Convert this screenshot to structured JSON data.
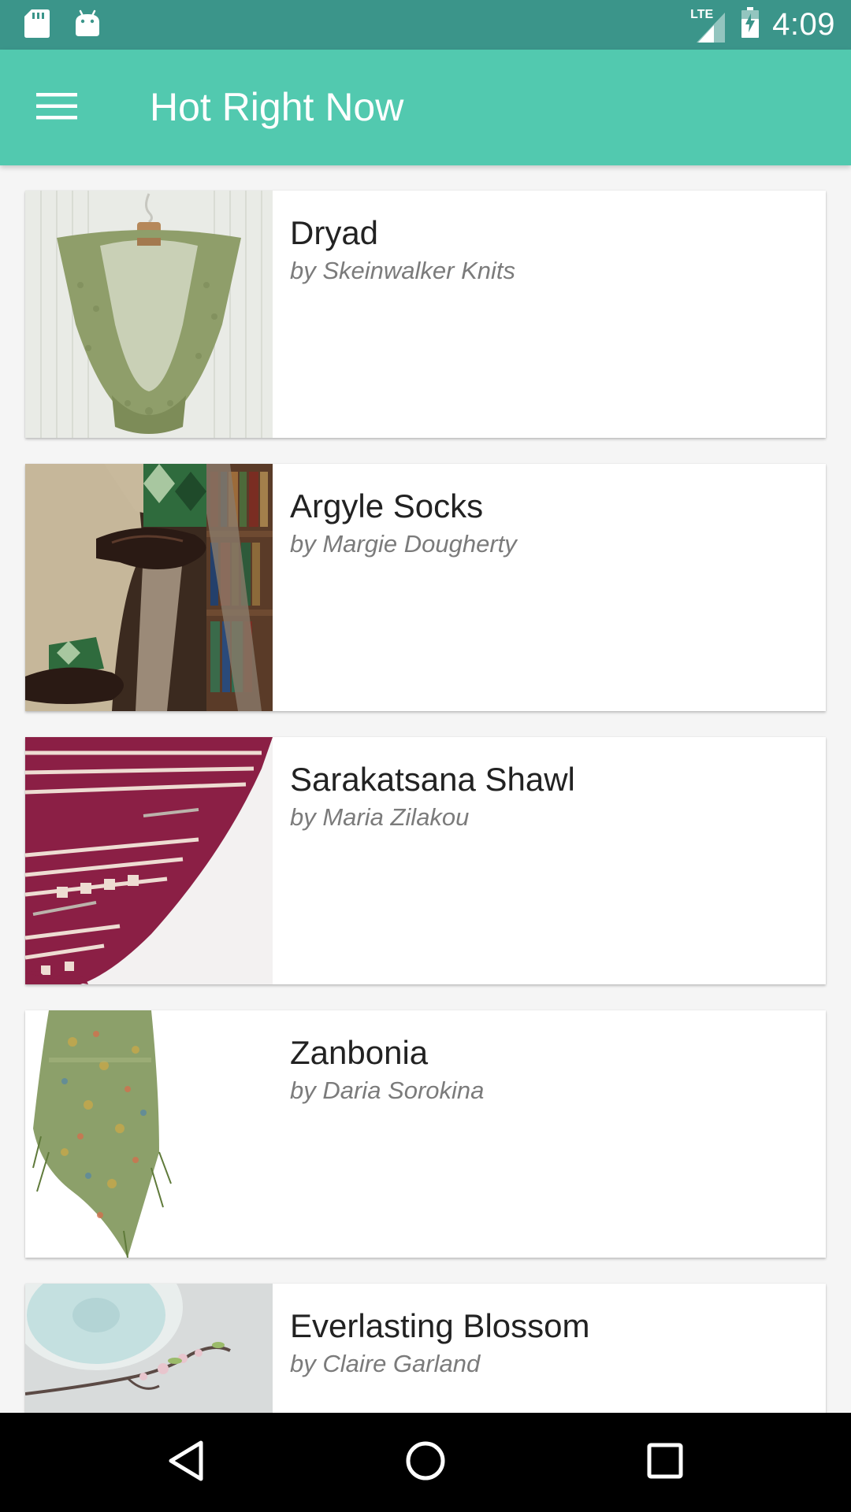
{
  "status_bar": {
    "time": "4:09",
    "network": "LTE",
    "icons": [
      "sd-card-icon",
      "android-icon",
      "signal-icon",
      "battery-icon"
    ]
  },
  "app_bar": {
    "title": "Hot Right Now",
    "menu_icon": "hamburger-menu-icon",
    "color": "#52c9af"
  },
  "patterns": [
    {
      "name": "Dryad",
      "author": "by Skeinwalker Knits"
    },
    {
      "name": "Argyle Socks",
      "author": "by Margie Dougherty"
    },
    {
      "name": "Sarakatsana Shawl",
      "author": "by Maria Zilakou"
    },
    {
      "name": "Zanbonia",
      "author": "by Daria Sorokina"
    },
    {
      "name": "Everlasting Blossom",
      "author": "by Claire Garland"
    }
  ],
  "nav_bar": {
    "icons": [
      "back-icon",
      "home-icon",
      "recents-icon"
    ]
  },
  "colors": {
    "status_bar": "#3b958a",
    "app_bar": "#52c9af",
    "background": "#f5f5f5"
  }
}
